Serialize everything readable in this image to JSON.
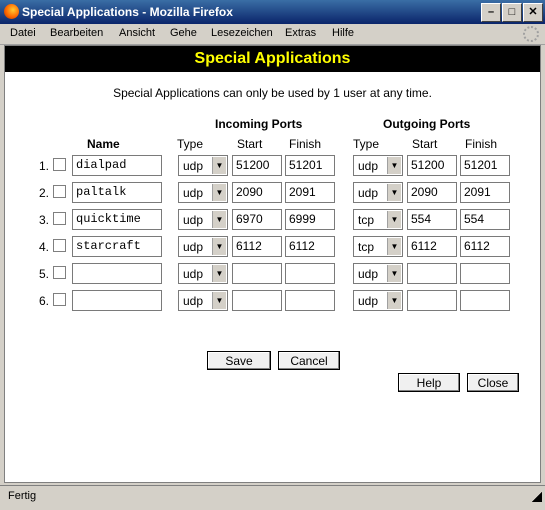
{
  "window": {
    "title": "Special Applications - Mozilla Firefox",
    "controls": {
      "minimize": "–",
      "maximize": "□",
      "close": "✕"
    }
  },
  "menubar": {
    "items": [
      "Datei",
      "Bearbeiten",
      "Ansicht",
      "Gehe",
      "Lesezeichen",
      "Extras",
      "Hilfe"
    ]
  },
  "page": {
    "header": "Special Applications",
    "note": "Special Applications can only be used by 1 user at any time.",
    "columns": {
      "incoming_group": "Incoming Ports",
      "outgoing_group": "Outgoing Ports",
      "name": "Name",
      "type": "Type",
      "start": "Start",
      "finish": "Finish"
    },
    "rows": [
      {
        "num": "1.",
        "name": "dialpad",
        "in_type": "udp",
        "in_start": "51200",
        "in_finish": "51201",
        "out_type": "udp",
        "out_start": "51200",
        "out_finish": "51201"
      },
      {
        "num": "2.",
        "name": "paltalk",
        "in_type": "udp",
        "in_start": "2090",
        "in_finish": "2091",
        "out_type": "udp",
        "out_start": "2090",
        "out_finish": "2091"
      },
      {
        "num": "3.",
        "name": "quicktime",
        "in_type": "udp",
        "in_start": "6970",
        "in_finish": "6999",
        "out_type": "tcp",
        "out_start": "554",
        "out_finish": "554"
      },
      {
        "num": "4.",
        "name": "starcraft",
        "in_type": "udp",
        "in_start": "6112",
        "in_finish": "6112",
        "out_type": "tcp",
        "out_start": "6112",
        "out_finish": "6112"
      },
      {
        "num": "5.",
        "name": "",
        "in_type": "udp",
        "in_start": "",
        "in_finish": "",
        "out_type": "udp",
        "out_start": "",
        "out_finish": ""
      },
      {
        "num": "6.",
        "name": "",
        "in_type": "udp",
        "in_start": "",
        "in_finish": "",
        "out_type": "udp",
        "out_start": "",
        "out_finish": ""
      }
    ],
    "buttons": {
      "save": "Save",
      "cancel": "Cancel",
      "help": "Help",
      "close": "Close"
    }
  },
  "statusbar": {
    "text": "Fertig"
  }
}
